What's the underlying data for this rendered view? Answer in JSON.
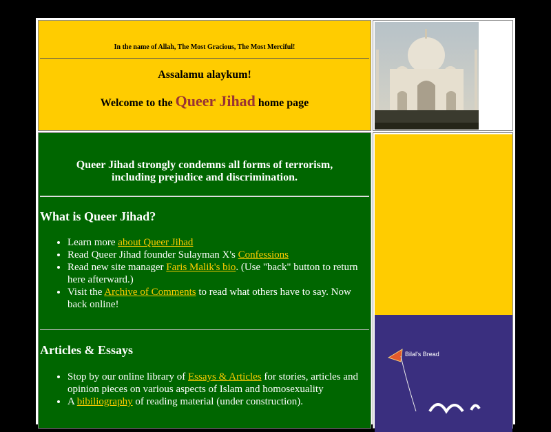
{
  "header": {
    "blessing": "In the name of Allah, The Most Gracious, The Most Merciful!",
    "greeting": "Assalamu alaykum!",
    "welcome_prefix": "Welcome to the",
    "brand": "Queer Jihad",
    "welcome_suffix": "home page"
  },
  "main": {
    "condemn_line1": "Queer Jihad strongly condemns all forms of terrorism,",
    "condemn_line2": "including prejudice and discrimination.",
    "what_heading": "What is Queer Jihad?",
    "items": [
      {
        "pre": "Learn more ",
        "link": "about Queer Jihad",
        "post": ""
      },
      {
        "pre": "Read Queer Jihad founder Sulayman X's ",
        "link": "Confessions",
        "post": ""
      },
      {
        "pre": "Read new site manager ",
        "link": "Faris Malik's bio",
        "post": ". (Use \"back\" button to return here afterward.)"
      },
      {
        "pre": "Visit the ",
        "link": "Archive of Comments",
        "post": " to read what others have to say. Now back online!"
      }
    ],
    "articles_heading": "Articles & Essays",
    "articles": [
      {
        "pre": "Stop by our online library of ",
        "link": "Essays & Articles",
        "post": " for stories, articles and opinion pieces on various aspects of Islam and homosexuality"
      },
      {
        "pre": "A ",
        "link": "bibiliography",
        "post": " of reading material (under construction)."
      }
    ]
  },
  "side": {
    "book_title": "Bilal's Bread"
  },
  "colors": {
    "yellow": "#FFCC00",
    "green": "#006600",
    "brand": "#993333",
    "link": "#FFCC00"
  }
}
